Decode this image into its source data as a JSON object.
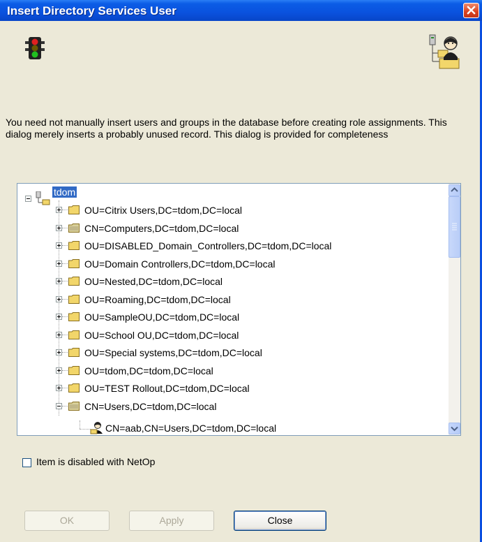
{
  "window": {
    "title": "Insert Directory Services User",
    "close_tooltip": "Close"
  },
  "icons": {
    "left": "traffic-light-icon",
    "right": "directory-user-icon",
    "close": "close-icon"
  },
  "description": "You need not manually insert users and groups in the database before creating role assignments. This dialog merely inserts a probably unused record. This dialog is provided for completeness",
  "tree": {
    "root": "tdom",
    "items": [
      {
        "label": "OU=Citrix Users,DC=tdom,DC=local",
        "type": "ou"
      },
      {
        "label": "CN=Computers,DC=tdom,DC=local",
        "type": "cn"
      },
      {
        "label": "OU=DISABLED_Domain_Controllers,DC=tdom,DC=local",
        "type": "ou"
      },
      {
        "label": "OU=Domain Controllers,DC=tdom,DC=local",
        "type": "ou"
      },
      {
        "label": "OU=Nested,DC=tdom,DC=local",
        "type": "ou"
      },
      {
        "label": "OU=Roaming,DC=tdom,DC=local",
        "type": "ou"
      },
      {
        "label": "OU=SampleOU,DC=tdom,DC=local",
        "type": "ou"
      },
      {
        "label": "OU=School OU,DC=tdom,DC=local",
        "type": "ou"
      },
      {
        "label": "OU=Special systems,DC=tdom,DC=local",
        "type": "ou"
      },
      {
        "label": "OU=tdom,DC=tdom,DC=local",
        "type": "ou"
      },
      {
        "label": "OU=TEST Rollout,DC=tdom,DC=local",
        "type": "ou"
      },
      {
        "label": "CN=Users,DC=tdom,DC=local",
        "type": "cn",
        "expanded": true
      }
    ],
    "child": "CN=aab,CN=Users,DC=tdom,DC=local"
  },
  "checkbox": {
    "label": "Item is disabled with NetOp",
    "checked": false
  },
  "buttons": {
    "ok": "OK",
    "apply": "Apply",
    "close": "Close"
  }
}
